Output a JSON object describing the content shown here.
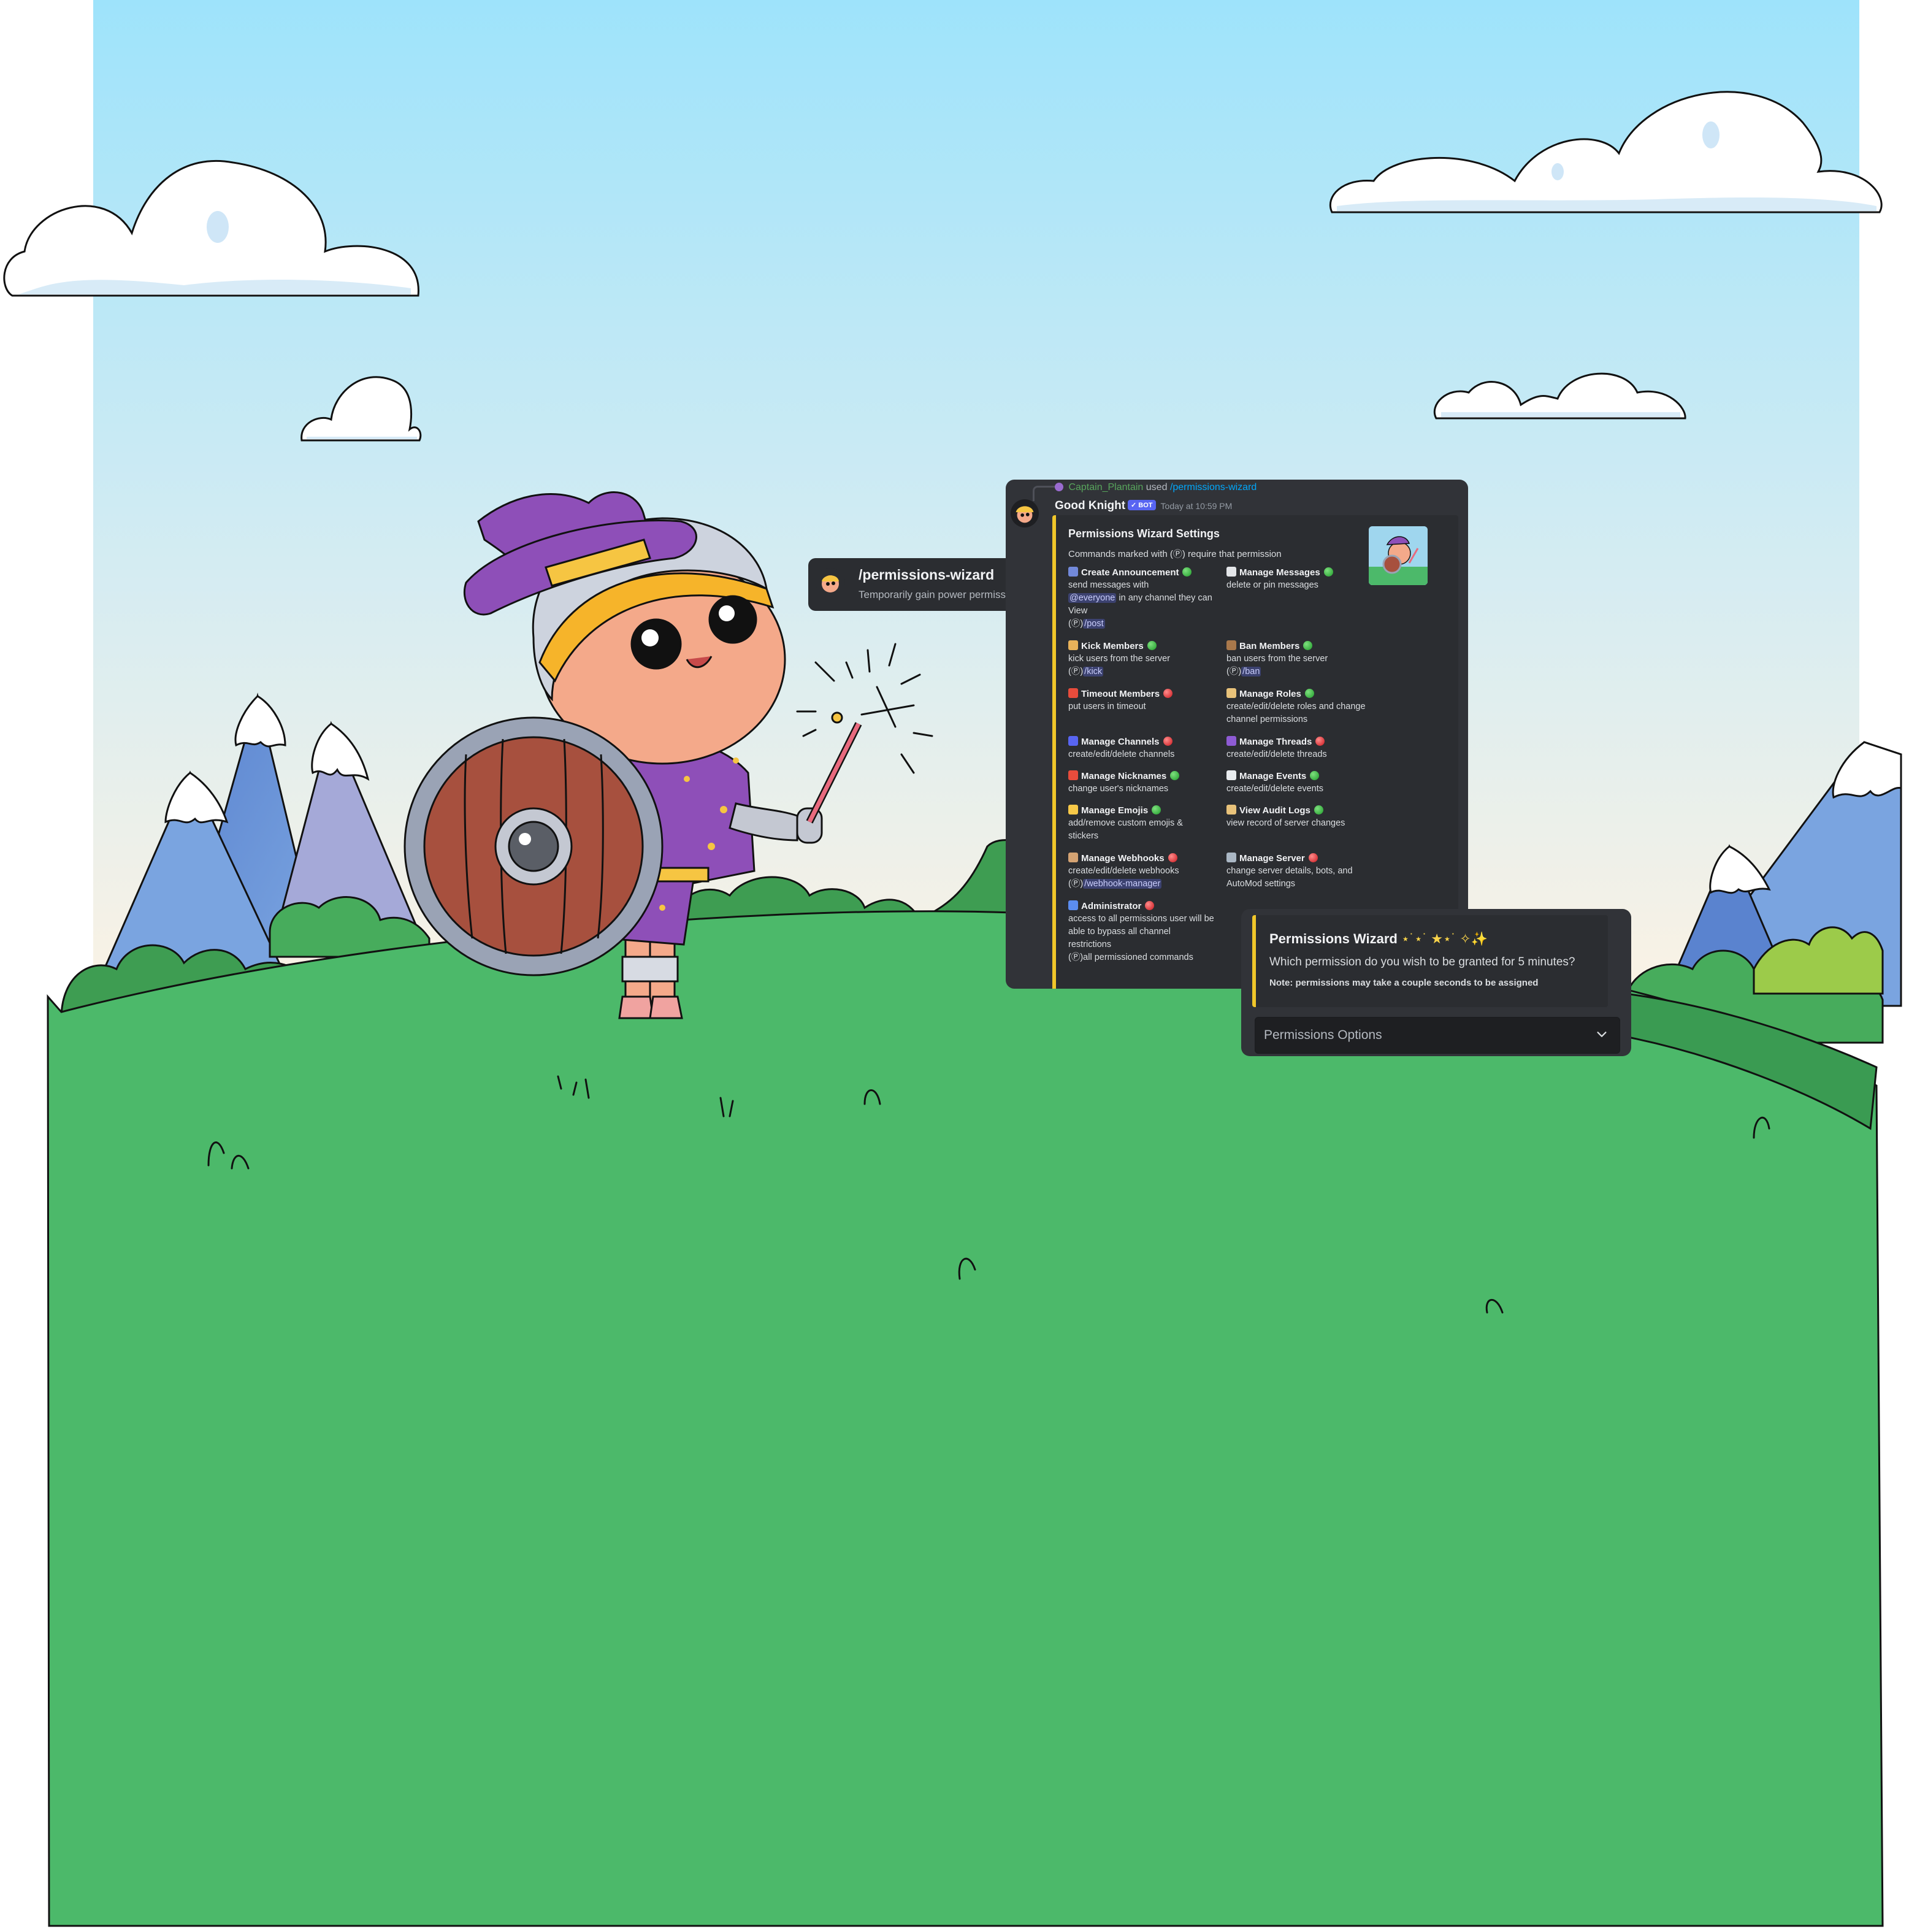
{
  "command_tooltip": {
    "name": "/permissions-wizard",
    "description": "Temporarily gain power permissions"
  },
  "message": {
    "reply": {
      "user": "Captain_Plantain",
      "used": "used",
      "command": "/permissions-wizard"
    },
    "author": "Good Knight",
    "bot_tag": "✓ BOT",
    "timestamp": "Today at 10:59 PM",
    "embed": {
      "title": "Permissions Wizard Settings",
      "description": "Commands marked with (Ⓟ) require that permission",
      "fields": [
        {
          "icon": "megaphone-icon",
          "color": "#7289da",
          "name": "Create Announcement",
          "status": "green",
          "value_parts": [
            "send messages with",
            "@everyone",
            " in any channel they can View",
            "(Ⓟ)",
            "/post"
          ]
        },
        {
          "icon": "speech-bubble-icon",
          "color": "#e3e5e8",
          "name": "Manage Messages",
          "status": "green",
          "value_parts": [
            "delete or pin messages"
          ]
        },
        {
          "icon": "boot-icon",
          "color": "#e8b25a",
          "name": "Kick Members",
          "status": "green",
          "value_parts": [
            "kick users from the server",
            "(Ⓟ)",
            "/kick"
          ]
        },
        {
          "icon": "hammer-icon",
          "color": "#a9784b",
          "name": "Ban Members",
          "status": "green",
          "value_parts": [
            "ban users from the server",
            "(Ⓟ)",
            "/ban"
          ]
        },
        {
          "icon": "alarm-clock-icon",
          "color": "#e74c3c",
          "name": "Timeout Members",
          "status": "red",
          "value_parts": [
            "put users in timeout"
          ]
        },
        {
          "icon": "scroll-icon",
          "color": "#e8c27a",
          "name": "Manage Roles",
          "status": "green",
          "value_parts": [
            "create/edit/delete roles and change channel permissions"
          ]
        },
        {
          "icon": "hash-icon",
          "color": "#5865f2",
          "name": "Manage Channels",
          "status": "red",
          "value_parts": [
            "create/edit/delete channels"
          ]
        },
        {
          "icon": "spool-icon",
          "color": "#8e5bd4",
          "name": "Manage Threads",
          "status": "red",
          "value_parts": [
            "create/edit/delete threads"
          ]
        },
        {
          "icon": "name-badge-icon",
          "color": "#e74c3c",
          "name": "Manage Nicknames",
          "status": "green",
          "value_parts": [
            "change user's nicknames"
          ]
        },
        {
          "icon": "calendar-icon",
          "color": "#e9ecef",
          "name": "Manage Events",
          "status": "green",
          "value_parts": [
            "create/edit/delete events"
          ]
        },
        {
          "icon": "emoji-icon",
          "color": "#f7c948",
          "name": "Manage Emojis",
          "status": "green",
          "value_parts": [
            "add/remove custom emojis & stickers"
          ]
        },
        {
          "icon": "scroll-log-icon",
          "color": "#e8c27a",
          "name": "View Audit Logs",
          "status": "green",
          "value_parts": [
            "view record of server changes"
          ]
        },
        {
          "icon": "hook-icon",
          "color": "#d4a373",
          "name": "Manage Webhooks",
          "status": "red",
          "value_parts": [
            "create/edit/delete webhooks",
            "(Ⓟ)",
            "/webhook-manager"
          ]
        },
        {
          "icon": "bank-icon",
          "color": "#aab7c4",
          "name": "Manage Server",
          "status": "red",
          "value_parts": [
            "change server details, bots, and AutoMod settings"
          ]
        },
        {
          "icon": "shield-icon",
          "color": "#5b8def",
          "name": "Administrator",
          "status": "red",
          "value_parts": [
            "access to all permissions user will be able to bypass all channel restrictions",
            "(Ⓟ)all permissioned commands"
          ]
        }
      ]
    }
  },
  "wizard": {
    "title": "Permissions Wizard",
    "sparkles": "⋆˙⋆˙ ★⋆˙ ✧✨",
    "question": "Which permission do you wish to be granted for 5 minutes?",
    "note": "Note: permissions may take a couple seconds to be assigned",
    "select_placeholder": "Permissions Options"
  },
  "colors": {
    "sky_top": "#9ee3fb",
    "sky_bottom": "#fff3e3",
    "grass": "#4cb96a",
    "discord_bg": "#313338",
    "embed_bg": "#2b2d31",
    "embed_accent": "#f0c62a",
    "blurple": "#5865f2"
  }
}
